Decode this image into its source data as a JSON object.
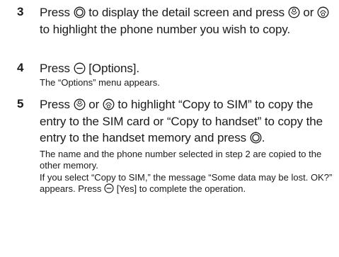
{
  "steps": [
    {
      "number": "3",
      "text": {
        "a": "Press",
        "b": "to display the detail screen and press",
        "c": "or",
        "d": "to highlight the phone number you wish to copy."
      }
    },
    {
      "number": "4",
      "text": {
        "a": "Press",
        "b": "[Options]."
      },
      "note": "The “Options” menu appears."
    },
    {
      "number": "5",
      "text": {
        "a": "Press",
        "b": "or",
        "c": "to highlight “Copy to SIM” to copy the entry to the SIM card or “Copy to handset” to copy the entry to the handset memory and press",
        "d": "."
      },
      "notes": {
        "n1": "The name and the phone number selected in step 2 are copied to the other memory.",
        "n2a": "If you select “Copy to SIM,” the message “Some data may be lost. OK?” appears. Press",
        "n2b": "[Yes] to complete the operation."
      }
    }
  ],
  "icons": {
    "center_key": "center-key-icon",
    "up_key": "up-key-icon",
    "down_key": "down-key-icon",
    "left_soft_key": "left-soft-key-icon"
  }
}
